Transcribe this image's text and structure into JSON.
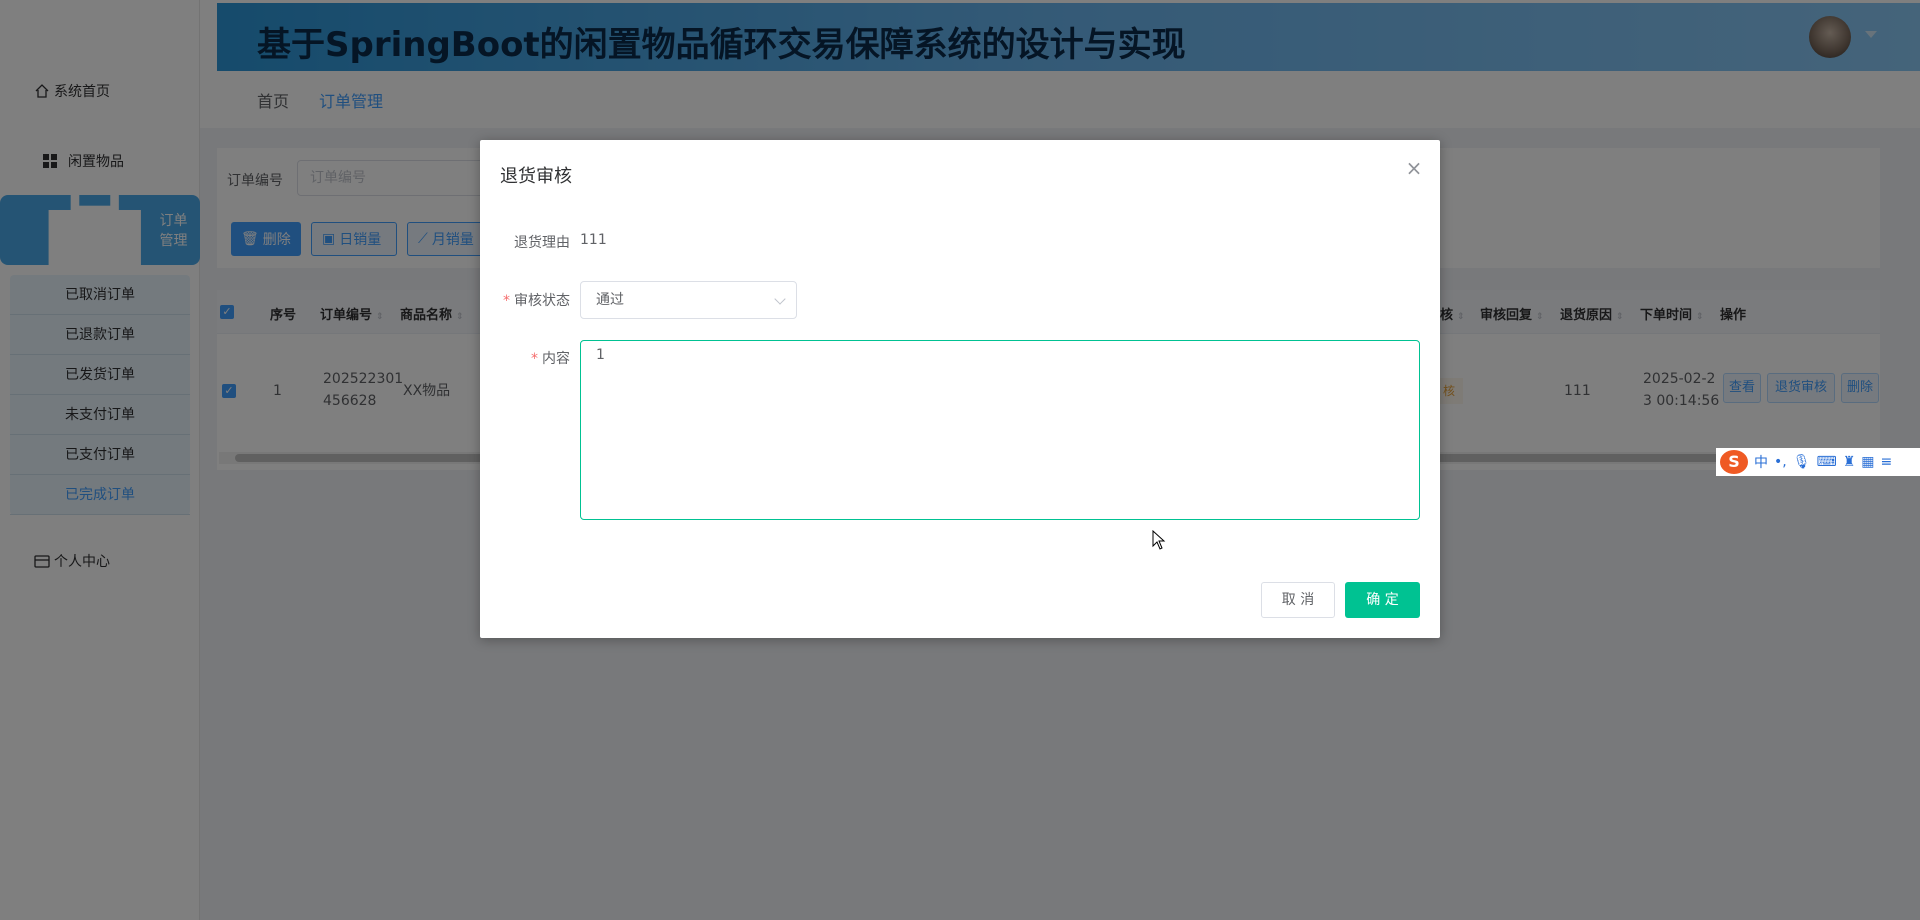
{
  "app": {
    "title": "基于SpringBoot的闲置物品循环交易保障系统的设计与实现"
  },
  "sidebar": {
    "items": [
      {
        "label": "系统首页",
        "icon": "home-icon"
      },
      {
        "label": "闲置物品",
        "icon": "grid-icon"
      },
      {
        "label": "订单管理",
        "icon": "briefcase-icon"
      },
      {
        "label": "个人中心",
        "icon": "wallet-icon"
      }
    ],
    "submenu": [
      "已取消订单",
      "已退款订单",
      "已发货订单",
      "未支付订单",
      "已支付订单",
      "已完成订单"
    ]
  },
  "breadcrumb": [
    "首页",
    "订单管理"
  ],
  "search": {
    "label": "订单编号",
    "placeholder": "订单编号"
  },
  "toolbar": {
    "delete_label": "删除",
    "daily_sales_label": "日销量",
    "monthly_sales_label": "月销量"
  },
  "table": {
    "headers": {
      "index": "序号",
      "order_no": "订单编号",
      "product_name": "商品名称",
      "audit": "核",
      "audit_reply": "审核回复",
      "return_reason": "退货原因",
      "order_time": "下单时间",
      "actions": "操作"
    },
    "rows": [
      {
        "index": "1",
        "order_no_line1": "202522301",
        "order_no_line2": "456628",
        "product_name": "XX物品",
        "audit_status": "核",
        "return_reason": "111",
        "order_time_line1": "2025-02-2",
        "order_time_line2": "3 00:14:56"
      }
    ],
    "action_buttons": {
      "view": "查看",
      "return_audit": "退货审核",
      "delete": "删除"
    }
  },
  "ime": {
    "logo": "S",
    "mode": "中",
    "punct": "•,"
  },
  "dialog": {
    "title": "退货审核",
    "return_reason_label": "退货理由",
    "return_reason_value": "111",
    "audit_status_label": "审核状态",
    "audit_status_value": "通过",
    "content_label": "内容",
    "content_value": "1",
    "cancel_label": "取 消",
    "confirm_label": "确 定"
  },
  "colors": {
    "primary": "#409eff",
    "confirm": "#00c292",
    "header_gradient_start": "#2c96d8"
  }
}
